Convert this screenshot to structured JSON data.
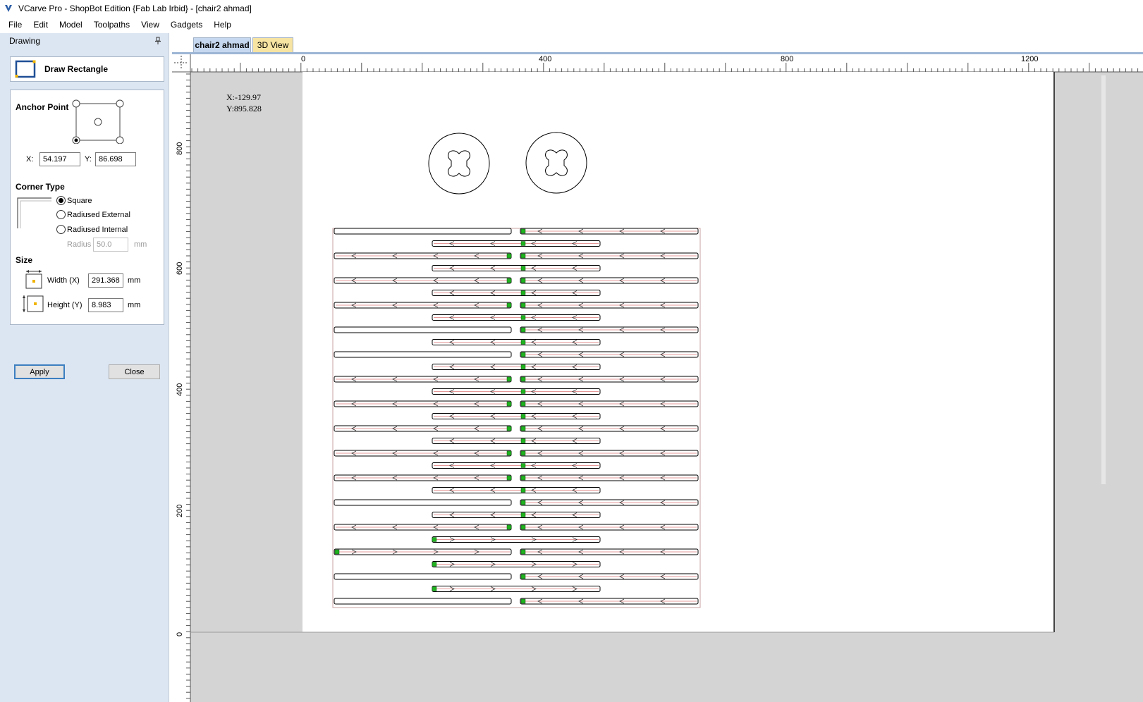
{
  "app": {
    "title": "VCarve Pro - ShopBot Edition {Fab Lab Irbid} - [chair2 ahmad]",
    "icon": "vcarve-logo-icon"
  },
  "menu": {
    "items": [
      "File",
      "Edit",
      "Model",
      "Toolpaths",
      "View",
      "Gadgets",
      "Help"
    ]
  },
  "panel": {
    "header": "Drawing",
    "tool_title": "Draw Rectangle",
    "anchor_point": {
      "label": "Anchor Point",
      "selected": "bottom-left",
      "x_label": "X:",
      "x_value": "54.197",
      "y_label": "Y:",
      "y_value": "86.698"
    },
    "corner_type": {
      "label": "Corner Type",
      "options": [
        "Square",
        "Radiused External",
        "Radiused Internal"
      ],
      "selected": "Square",
      "radius_label": "Radius",
      "radius_value": "50.0",
      "radius_unit": "mm"
    },
    "size": {
      "label": "Size",
      "width_label": "Width (X)",
      "width_value": "291.368",
      "width_unit": "mm",
      "height_label": "Height (Y)",
      "height_value": "8.983",
      "height_unit": "mm"
    },
    "apply_label": "Apply",
    "close_label": "Close"
  },
  "tabs": [
    {
      "label": "chair2 ahmad",
      "active": true
    },
    {
      "label": "3D View",
      "active": false
    }
  ],
  "view": {
    "cursor_x": "X:-129.97",
    "cursor_y": "Y:895.828",
    "h_ruler_labels": [
      "0",
      "400",
      "800",
      "1200"
    ],
    "v_ruler_labels": [
      "800",
      "600",
      "400",
      "200",
      "0"
    ]
  },
  "colors": {
    "panel_bg": "#dce6f2",
    "selection_accent": "#3c7fc1",
    "start_marker": "#1fb31f",
    "toolpath_red": "#cc3333",
    "tab_active": "#c6d8ef",
    "tab_3d": "#f7e4a3"
  }
}
